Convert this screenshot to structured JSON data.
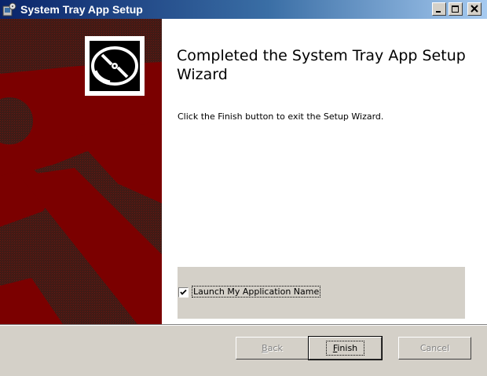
{
  "window": {
    "title": "System Tray App Setup",
    "icon": "setup-installer-icon",
    "controls": [
      "minimize-icon",
      "maximize-icon",
      "close-icon"
    ]
  },
  "banner": {
    "icon": "cd-disc-icon",
    "colors": {
      "red": "#7b0000",
      "dark": "#3b1c17"
    }
  },
  "main": {
    "heading": "Completed the System Tray App Setup Wizard",
    "description": "Click the Finish button to exit the Setup Wizard."
  },
  "launch_option": {
    "checked": true,
    "label": "Launch My Application Name"
  },
  "buttons": {
    "back": {
      "pre": "",
      "accel": "B",
      "post": "ack",
      "enabled": false
    },
    "finish": {
      "pre": "",
      "accel": "F",
      "post": "inish",
      "enabled": true,
      "default": true
    },
    "cancel": {
      "pre": "Cancel",
      "accel": "",
      "post": "",
      "enabled": false
    }
  }
}
